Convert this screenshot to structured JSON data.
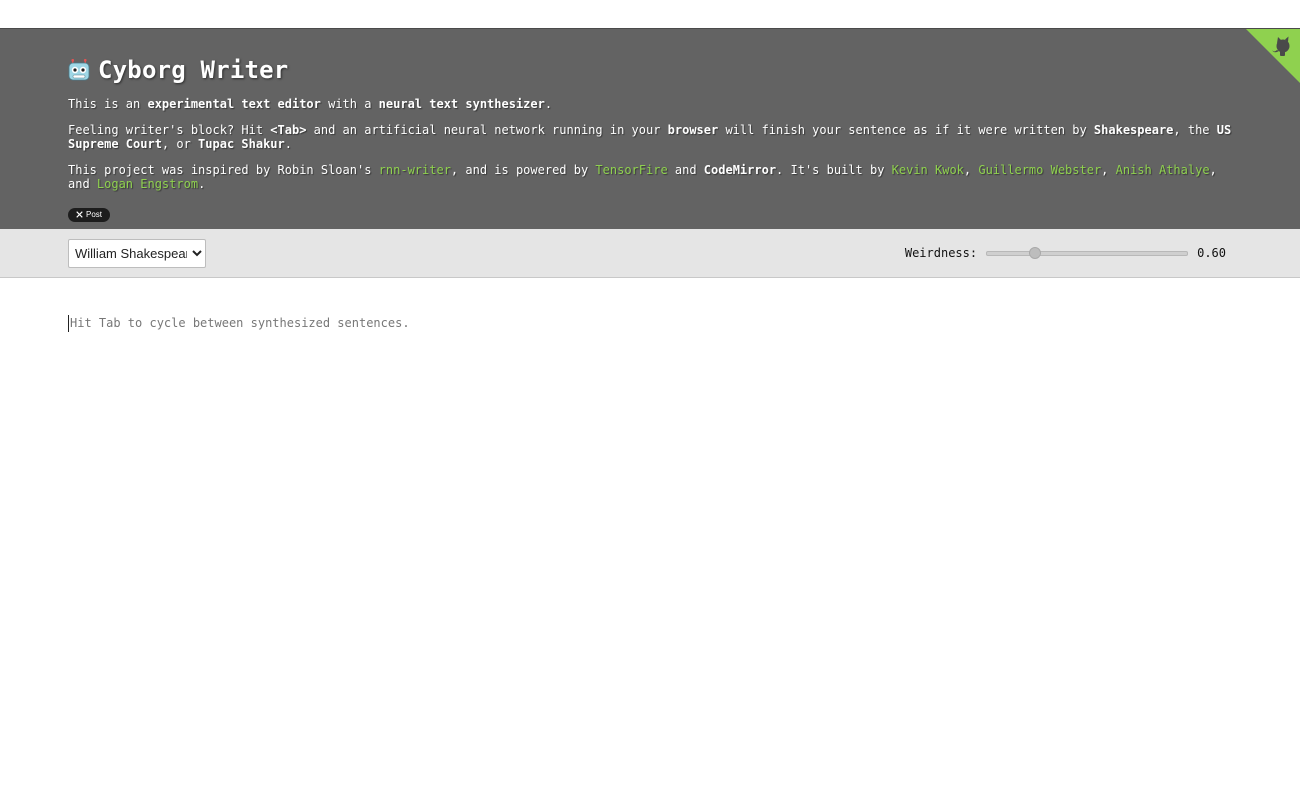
{
  "header": {
    "title": "Cyborg Writer",
    "intro": {
      "t1": "This is an ",
      "b1": "experimental text editor",
      "t2": " with a ",
      "b2": "neural text synthesizer",
      "t3": "."
    },
    "feeling": {
      "t1": "Feeling writer's block? Hit ",
      "b1": "<Tab>",
      "t2": " and an artificial neural network running in your ",
      "b2": "browser",
      "t3": " will finish your sentence as if it were written by ",
      "b3": "Shakespeare",
      "t4": ", the ",
      "b4": "US Supreme Court",
      "t5": ", or ",
      "b5": "Tupac Shakur",
      "t6": "."
    },
    "credits": {
      "t1": "This project was inspired by Robin Sloan's ",
      "link_rnn": "rnn-writer",
      "t2": ", and is powered by ",
      "link_tensorfire": "TensorFire",
      "t3": " and ",
      "b_codemirror": "CodeMirror",
      "t4": ". It's built by ",
      "link_kevin": "Kevin Kwok",
      "sep1": ", ",
      "link_guillermo": "Guillermo Webster",
      "sep2": ", ",
      "link_anish": "Anish Athalye",
      "t5": ", and ",
      "link_logan": "Logan Engstrom",
      "t6": "."
    },
    "tweet_label": "Post",
    "tweet_icon": "x-logo-icon",
    "corner_icon": "github-octocat-icon"
  },
  "toolbar": {
    "author_selected": "William Shakespeare",
    "weirdness_label": "Weirdness:",
    "weirdness_value": "0.60",
    "weirdness_fraction": 0.24
  },
  "editor": {
    "placeholder": "Hit Tab to cycle between synthesized sentences."
  },
  "colors": {
    "header_bg": "#636363",
    "link": "#8fd14f",
    "toolbar_bg": "#e5e5e5"
  }
}
